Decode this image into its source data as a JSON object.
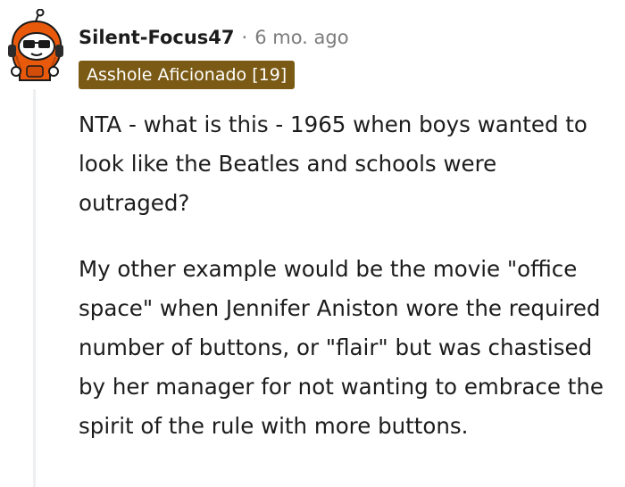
{
  "comment": {
    "username": "Silent-Focus47",
    "separator": "·",
    "timestamp": "6 mo. ago",
    "flair": "Asshole Aficionado [19]",
    "paragraphs": [
      "NTA - what is this - 1965 when boys wanted to look like the Beatles and schools were outraged?",
      "My other example would be the movie \"office space\" when Jennifer Aniston wore the required number of buttons, or \"flair\" but was chastised by her manager for not wanting to embrace the spirit of the rule with more buttons."
    ]
  },
  "avatar": {
    "icon": "snoo-avatar-icon",
    "colors": {
      "hood": "#e8590c",
      "face": "#ffffff",
      "glasses": "#1a1a1a",
      "headphones": "#2b2b2b"
    }
  },
  "colors": {
    "flair_background": "#7a5a14",
    "flair_text": "#ffffff",
    "meta_gray": "#7c7c7c",
    "thread_line": "#edeff1",
    "text": "#1c1c1c"
  }
}
